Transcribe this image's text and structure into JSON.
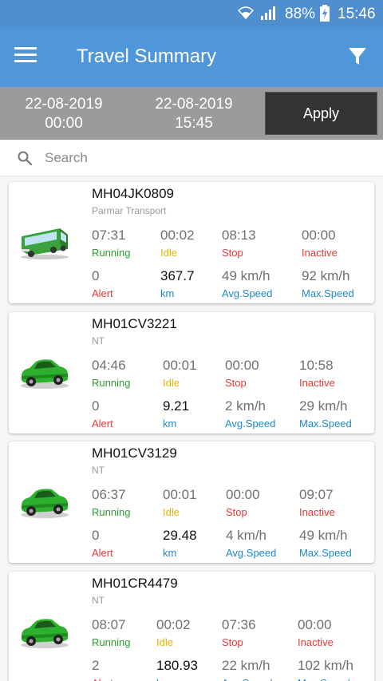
{
  "status_bar": {
    "battery_percent": "88%",
    "time": "15:46"
  },
  "app_bar": {
    "title": "Travel Summary",
    "menu_icon": "menu-icon",
    "filter_icon": "filter-icon"
  },
  "date_range": {
    "from_date": "22-08-2019",
    "from_time": "00:00",
    "to_date": "22-08-2019",
    "to_time": "15:45",
    "apply_label": "Apply"
  },
  "search": {
    "placeholder": "Search",
    "value": ""
  },
  "labels": {
    "running": "Running",
    "idle": "Idle",
    "stop": "Stop",
    "inactive": "Inactive",
    "alert": "Alert",
    "km": "km",
    "avg_speed": "Avg.Speed",
    "max_speed": "Max.Speed"
  },
  "colors": {
    "running": "#2e9c2e",
    "idle": "#e6b400",
    "stop": "#e53935",
    "inactive": "#e53935",
    "alert": "#e53935",
    "km": "#1e88c7",
    "speed": "#1e88c7",
    "app_bar": "#5096db"
  },
  "vehicles": [
    {
      "plate": "MH04JK0809",
      "owner": "Parmar Transport",
      "type_icon": "bus-icon",
      "running": "07:31",
      "idle": "00:02",
      "stop": "08:13",
      "inactive": "00:00",
      "alerts": "0",
      "distance": "367.7",
      "avg_speed": "49 km/h",
      "max_speed": "92 km/h"
    },
    {
      "plate": "MH01CV3221",
      "owner": "NT",
      "type_icon": "car-icon",
      "running": "04:46",
      "idle": "00:01",
      "stop": "00:00",
      "inactive": "10:58",
      "alerts": "0",
      "distance": "9.21",
      "avg_speed": "2 km/h",
      "max_speed": "29 km/h"
    },
    {
      "plate": "MH01CV3129",
      "owner": "NT",
      "type_icon": "car-icon",
      "running": "06:37",
      "idle": "00:01",
      "stop": "00:00",
      "inactive": "09:07",
      "alerts": "0",
      "distance": "29.48",
      "avg_speed": "4 km/h",
      "max_speed": "49 km/h"
    },
    {
      "plate": "MH01CR4479",
      "owner": "NT",
      "type_icon": "car-icon",
      "running": "08:07",
      "idle": "00:02",
      "stop": "07:36",
      "inactive": "00:00",
      "alerts": "2",
      "distance": "180.93",
      "avg_speed": "22 km/h",
      "max_speed": "102 km/h"
    }
  ]
}
